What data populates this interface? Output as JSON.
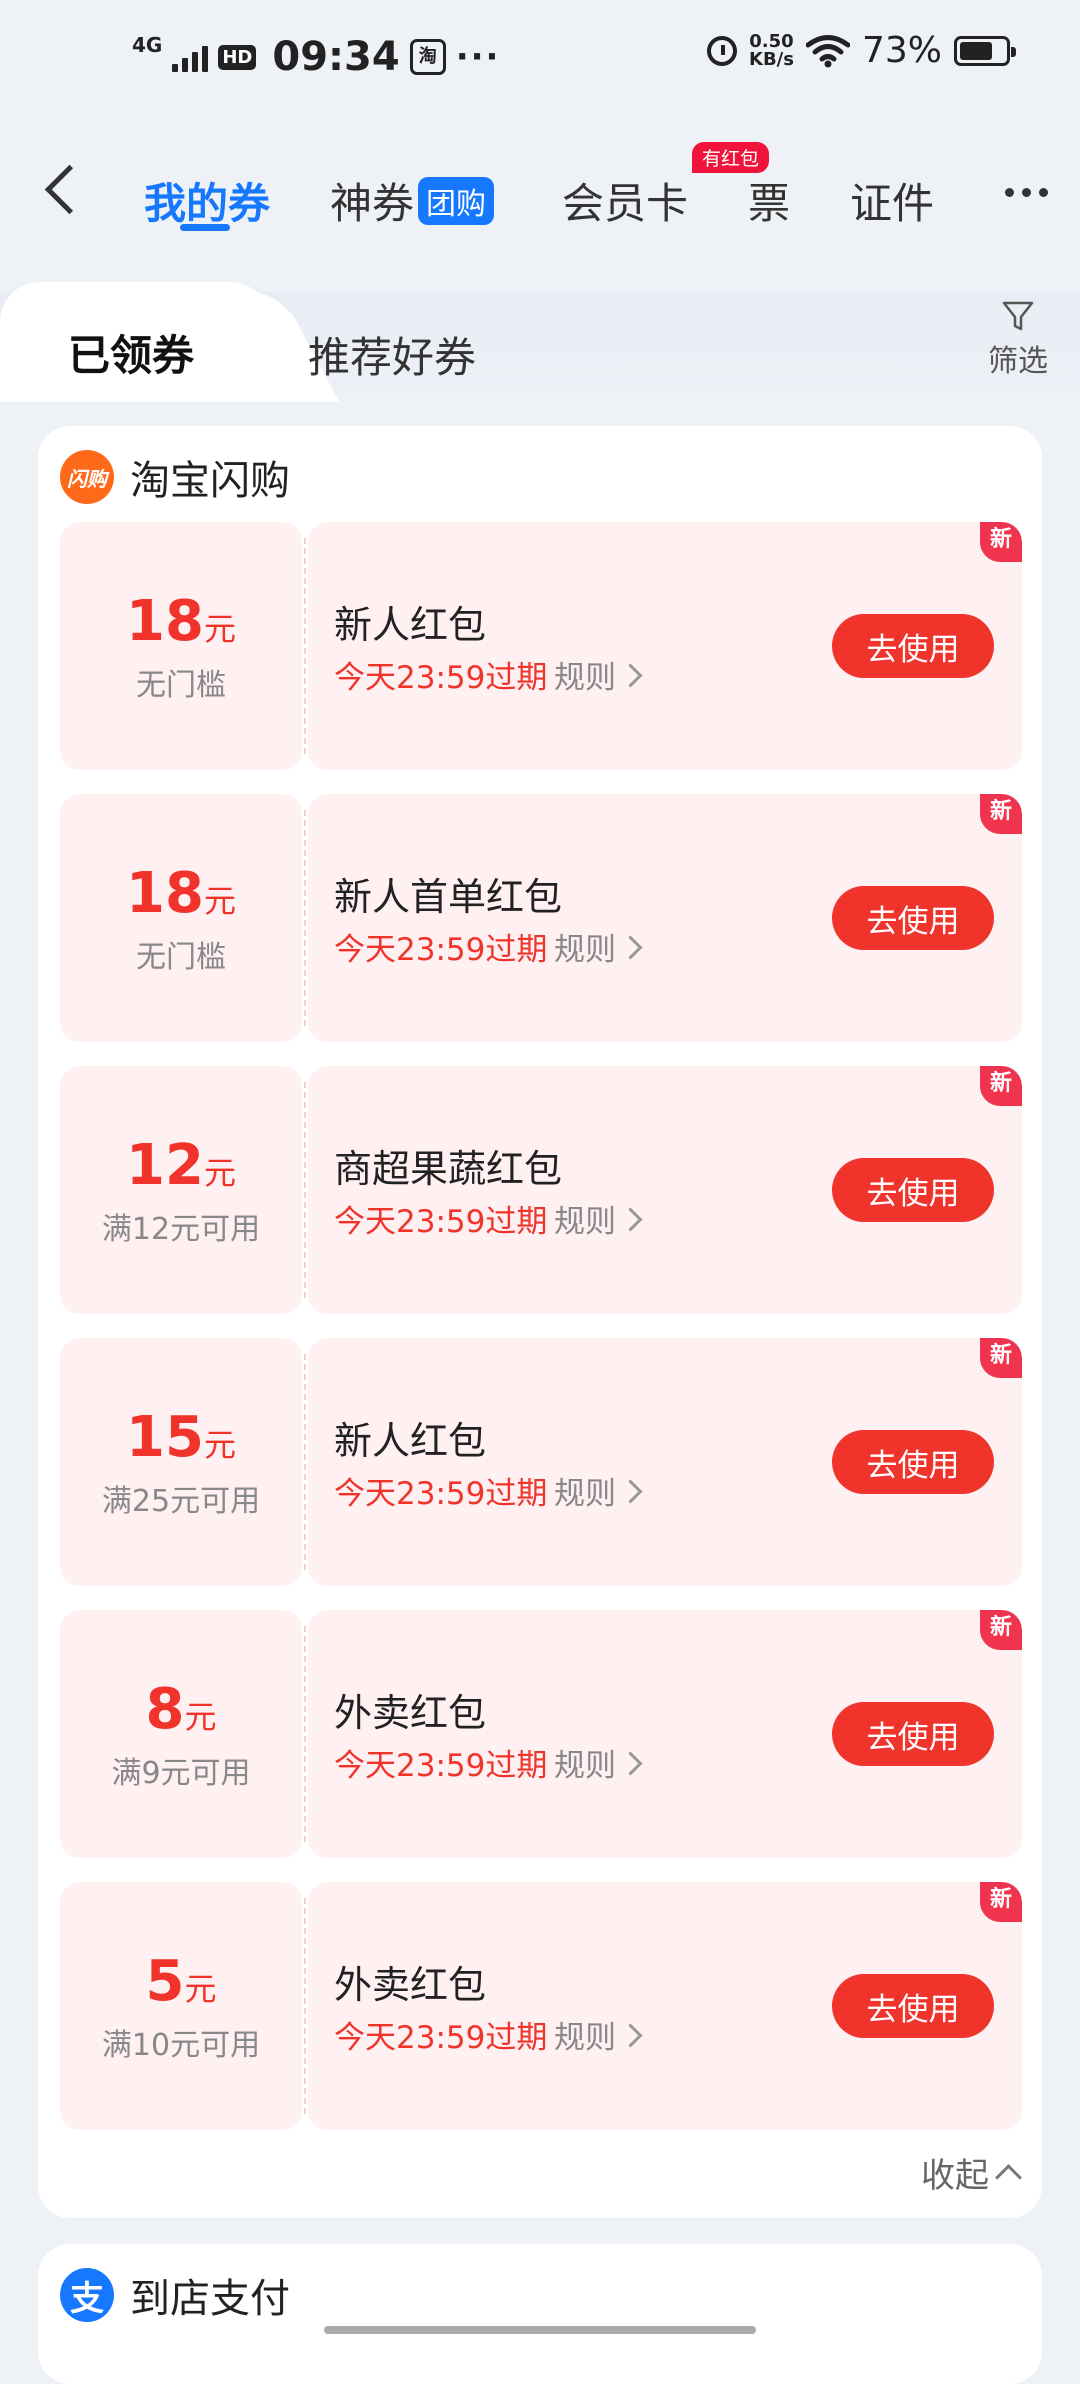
{
  "status": {
    "network": "4G",
    "hd": "HD",
    "time": "09:34",
    "app_icon": "淘",
    "dots": "···",
    "speed_value": "0.50",
    "speed_unit": "KB/s",
    "battery": "73%",
    "battery_level": 0.73
  },
  "nav": {
    "tabs": [
      {
        "label": "我的券"
      },
      {
        "label": "神券",
        "badge": "团购"
      },
      {
        "label": "会员卡"
      },
      {
        "label": "票"
      },
      {
        "label": "证件"
      }
    ],
    "hongbao_badge": "有红包"
  },
  "subtabs": {
    "active": "已领券",
    "other": "推荐好券",
    "filter": "筛选"
  },
  "section": {
    "logo": "闪购",
    "title": "淘宝闪购",
    "coupons": [
      {
        "amount": "18",
        "unit": "元",
        "condition": "无门槛",
        "name": "新人红包",
        "expiry": "今天23:59过期",
        "rule": "规则",
        "button": "去使用",
        "tag": "新"
      },
      {
        "amount": "18",
        "unit": "元",
        "condition": "无门槛",
        "name": "新人首单红包",
        "expiry": "今天23:59过期",
        "rule": "规则",
        "button": "去使用",
        "tag": "新"
      },
      {
        "amount": "12",
        "unit": "元",
        "condition": "满12元可用",
        "name": "商超果蔬红包",
        "expiry": "今天23:59过期",
        "rule": "规则",
        "button": "去使用",
        "tag": "新"
      },
      {
        "amount": "15",
        "unit": "元",
        "condition": "满25元可用",
        "name": "新人红包",
        "expiry": "今天23:59过期",
        "rule": "规则",
        "button": "去使用",
        "tag": "新"
      },
      {
        "amount": "8",
        "unit": "元",
        "condition": "满9元可用",
        "name": "外卖红包",
        "expiry": "今天23:59过期",
        "rule": "规则",
        "button": "去使用",
        "tag": "新"
      },
      {
        "amount": "5",
        "unit": "元",
        "condition": "满10元可用",
        "name": "外卖红包",
        "expiry": "今天23:59过期",
        "rule": "规则",
        "button": "去使用",
        "tag": "新"
      }
    ],
    "collapse": "收起"
  },
  "section2": {
    "logo": "支",
    "title": "到店支付"
  },
  "colors": {
    "brand_blue": "#1677ff",
    "coupon_red": "#f0342b",
    "coupon_bg": "#fff0f2"
  }
}
